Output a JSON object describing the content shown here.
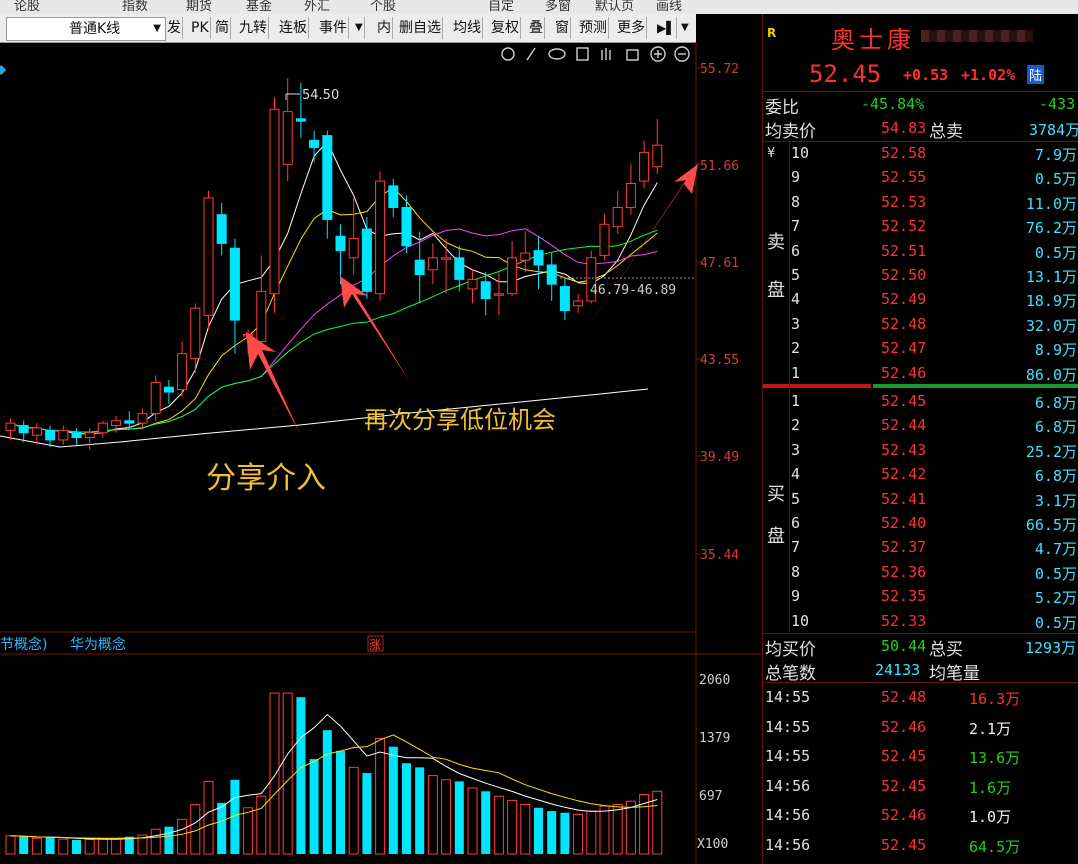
{
  "top_menu": [
    "论股",
    "指数",
    "期货",
    "基金",
    "外汇",
    "个股",
    "自定",
    "多窗",
    "默认页",
    "画线"
  ],
  "toolbar": {
    "period": "普通K线",
    "items": [
      "发",
      "PK",
      "简",
      "九转",
      "连板",
      "事件",
      "内",
      "删自选",
      "均线",
      "复权",
      "叠",
      "窗",
      "预测",
      "更多"
    ]
  },
  "chart": {
    "price_axis": [
      "55.72",
      "51.66",
      "47.61",
      "43.55",
      "39.49",
      "35.44"
    ],
    "volume_axis": [
      "2060",
      "1379",
      "697",
      "X100"
    ],
    "high_marker": "54.50",
    "range_label": "46.79-46.89",
    "concepts": "节概念)",
    "concept2": "华为概念",
    "zhang_badge": "涨",
    "annotation_1": "分享介入",
    "annotation_2": "再次分享低位机会",
    "colors": {
      "up": "#ff3b3b",
      "down": "#00e5ff",
      "ma5": "#ffffff",
      "ma10": "#ffe000",
      "ma20": "#ff40ff",
      "ma60": "#00ff40",
      "annotation": "#f0c030",
      "arrow": "#ff4a4a"
    },
    "chart_data": {
      "type": "candlestick",
      "candles": [
        [
          40.6,
          40.9,
          40.2,
          41.1
        ],
        [
          40.8,
          40.5,
          40.1,
          41.0
        ],
        [
          40.4,
          40.7,
          40.0,
          40.9
        ],
        [
          40.6,
          40.2,
          39.9,
          40.8
        ],
        [
          40.2,
          40.6,
          40.0,
          40.8
        ],
        [
          40.5,
          40.3,
          40.0,
          40.7
        ],
        [
          40.3,
          40.5,
          39.8,
          40.7
        ],
        [
          40.5,
          40.9,
          40.3,
          41.0
        ],
        [
          40.8,
          41.0,
          40.5,
          41.2
        ],
        [
          41.0,
          40.9,
          40.6,
          41.4
        ],
        [
          40.9,
          41.3,
          40.7,
          41.5
        ],
        [
          41.3,
          42.6,
          41.0,
          42.9
        ],
        [
          42.4,
          42.2,
          41.7,
          42.7
        ],
        [
          42.3,
          43.8,
          42.0,
          44.3
        ],
        [
          43.6,
          45.7,
          43.0,
          45.9
        ],
        [
          45.4,
          50.3,
          44.8,
          50.6
        ],
        [
          49.6,
          48.4,
          47.9,
          50.1
        ],
        [
          48.2,
          45.2,
          43.8,
          48.6
        ],
        [
          44.6,
          44.6,
          43.8,
          44.8
        ],
        [
          44.3,
          46.4,
          43.9,
          47.9
        ],
        [
          46.3,
          54.0,
          45.5,
          54.5
        ],
        [
          51.7,
          53.9,
          51.0,
          55.3
        ],
        [
          53.6,
          53.5,
          52.8,
          55.1
        ],
        [
          52.7,
          52.4,
          51.8,
          53.1
        ],
        [
          52.9,
          49.4,
          48.6,
          53.1
        ],
        [
          48.7,
          48.1,
          46.7,
          49.2
        ],
        [
          47.8,
          48.6,
          47.1,
          50.3
        ],
        [
          49.0,
          46.4,
          46.1,
          49.5
        ],
        [
          46.3,
          51.0,
          46.0,
          51.4
        ],
        [
          50.8,
          49.9,
          49.5,
          51.1
        ],
        [
          49.9,
          48.3,
          48.0,
          50.4
        ],
        [
          47.7,
          47.1,
          45.9,
          48.9
        ],
        [
          47.3,
          47.8,
          46.7,
          48.4
        ],
        [
          47.8,
          47.8,
          46.3,
          48.6
        ],
        [
          47.8,
          46.9,
          46.4,
          48.3
        ],
        [
          46.5,
          46.9,
          45.9,
          47.3
        ],
        [
          46.8,
          46.1,
          45.4,
          47.2
        ],
        [
          46.3,
          46.3,
          45.4,
          47.2
        ],
        [
          46.3,
          47.8,
          46.2,
          48.5
        ],
        [
          47.7,
          48.0,
          47.2,
          48.9
        ],
        [
          48.1,
          47.5,
          46.5,
          48.7
        ],
        [
          47.5,
          46.7,
          46.0,
          48.0
        ],
        [
          46.6,
          45.6,
          45.2,
          47.0
        ],
        [
          45.8,
          46.0,
          45.5,
          46.3
        ],
        [
          46.0,
          47.8,
          45.9,
          48.1
        ],
        [
          47.9,
          49.2,
          47.7,
          49.6
        ],
        [
          49.1,
          49.9,
          48.8,
          50.6
        ],
        [
          49.9,
          50.9,
          49.6,
          51.7
        ],
        [
          51.0,
          52.2,
          50.7,
          52.7
        ],
        [
          51.6,
          52.5,
          51.3,
          53.6
        ]
      ],
      "volumes": [
        220,
        210,
        190,
        200,
        180,
        170,
        175,
        180,
        190,
        210,
        230,
        300,
        330,
        420,
        600,
        880,
        620,
        900,
        560,
        700,
        1950,
        1950,
        1900,
        1150,
        1500,
        1250,
        1050,
        980,
        1400,
        1300,
        1100,
        1050,
        950,
        900,
        880,
        800,
        760,
        700,
        650,
        600,
        560,
        520,
        500,
        480,
        520,
        580,
        600,
        640,
        720,
        760
      ]
    }
  },
  "panel": {
    "logo": "R",
    "name": "奥士康",
    "price": "52.45",
    "change": "+0.53",
    "change_pct": "+1.02%",
    "market_tag": "陆",
    "weibi_label": "委比",
    "weibi_value": "-45.84%",
    "weicha_value": "-433",
    "avg_sell_label": "均卖价",
    "avg_sell_value": "54.83",
    "total_sell_label": "总卖",
    "total_sell_value": "3784万",
    "yen": "¥",
    "sell_side_label": [
      "卖",
      "盘"
    ],
    "buy_side_label": [
      "买",
      "盘"
    ],
    "sell_orders": [
      {
        "level": "10",
        "price": "52.58",
        "vol": "7.9万"
      },
      {
        "level": "9",
        "price": "52.55",
        "vol": "0.5万"
      },
      {
        "level": "8",
        "price": "52.53",
        "vol": "11.0万"
      },
      {
        "level": "7",
        "price": "52.52",
        "vol": "76.2万"
      },
      {
        "level": "6",
        "price": "52.51",
        "vol": "0.5万"
      },
      {
        "level": "5",
        "price": "52.50",
        "vol": "13.1万"
      },
      {
        "level": "4",
        "price": "52.49",
        "vol": "18.9万"
      },
      {
        "level": "3",
        "price": "52.48",
        "vol": "32.0万"
      },
      {
        "level": "2",
        "price": "52.47",
        "vol": "8.9万"
      },
      {
        "level": "1",
        "price": "52.46",
        "vol": "86.0万"
      }
    ],
    "buy_orders": [
      {
        "level": "1",
        "price": "52.45",
        "vol": "6.8万"
      },
      {
        "level": "2",
        "price": "52.44",
        "vol": "6.8万"
      },
      {
        "level": "3",
        "price": "52.43",
        "vol": "25.2万"
      },
      {
        "level": "4",
        "price": "52.42",
        "vol": "6.8万"
      },
      {
        "level": "5",
        "price": "52.41",
        "vol": "3.1万"
      },
      {
        "level": "6",
        "price": "52.40",
        "vol": "66.5万"
      },
      {
        "level": "7",
        "price": "52.37",
        "vol": "4.7万"
      },
      {
        "level": "8",
        "price": "52.36",
        "vol": "0.5万"
      },
      {
        "level": "9",
        "price": "52.35",
        "vol": "5.2万"
      },
      {
        "level": "10",
        "price": "52.33",
        "vol": "0.5万"
      }
    ],
    "avg_buy_label": "均买价",
    "avg_buy_value": "50.44",
    "total_buy_label": "总买",
    "total_buy_value": "1293万",
    "trades_label": "总笔数",
    "trades_value": "24133",
    "avg_trade_label": "均笔量",
    "ticks": [
      {
        "time": "14:55",
        "price": "52.48",
        "vol": "16.3万",
        "color": "red"
      },
      {
        "time": "14:55",
        "price": "52.46",
        "vol": "2.1万",
        "color": "white"
      },
      {
        "time": "14:55",
        "price": "52.45",
        "vol": "13.6万",
        "color": "green"
      },
      {
        "time": "14:56",
        "price": "52.45",
        "vol": "1.6万",
        "color": "green"
      },
      {
        "time": "14:56",
        "price": "52.46",
        "vol": "1.0万",
        "color": "white"
      },
      {
        "time": "14:56",
        "price": "52.45",
        "vol": "64.5万",
        "color": "green"
      }
    ]
  }
}
